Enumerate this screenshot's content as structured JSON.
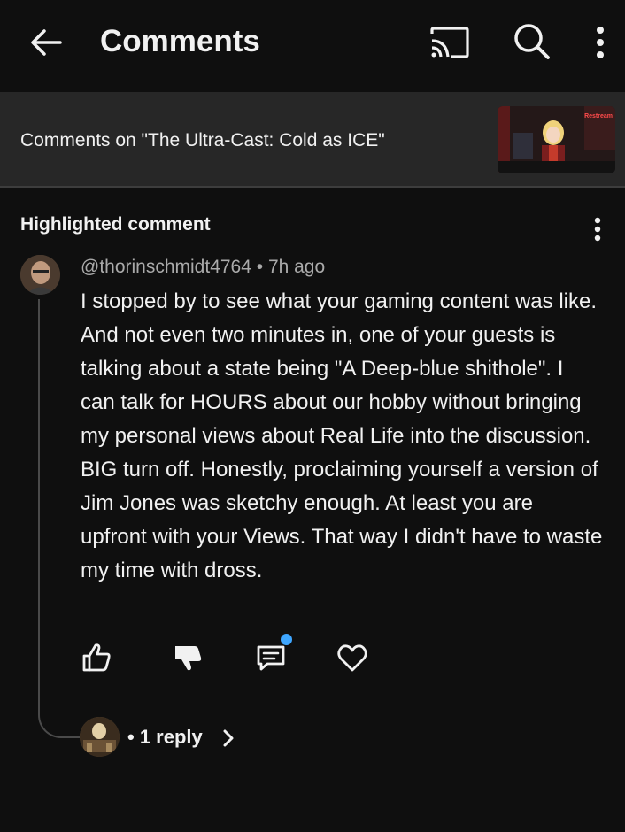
{
  "header": {
    "title": "Comments",
    "icons": [
      "back-arrow-icon",
      "cast-icon",
      "search-icon",
      "more-vert-icon"
    ]
  },
  "video": {
    "comments_on": "Comments on \"The Ultra-Cast:  Cold as ICE\"",
    "thumbnail_text": "Restream"
  },
  "highlighted": {
    "label": "Highlighted comment",
    "author": "@thorinschmidt4764",
    "separator": "•",
    "time": "7h ago",
    "meta": "@thorinschmidt4764 • 7h ago",
    "text": "I stopped by to see what your gaming content was like. And not even two minutes in, one of your guests is talking about a state being \"A Deep-blue shithole\". I can talk for HOURS about our hobby without bringing my personal views about Real Life into the discussion. BIG turn off. Honestly, proclaiming yourself a version of Jim Jones was sketchy enough. At least you are upfront with your Views. That way I didn't have to waste my time with dross.",
    "actions": [
      "thumbs-up-icon",
      "thumbs-down-icon",
      "reply-icon",
      "heart-icon"
    ],
    "reply_dot_color": "#3ea6ff"
  },
  "replies": {
    "label": "• 1 reply"
  },
  "colors": {
    "background": "#0f0f0f",
    "strip": "#272727",
    "text": "#f1f1f1",
    "meta": "#aaaaaa"
  }
}
